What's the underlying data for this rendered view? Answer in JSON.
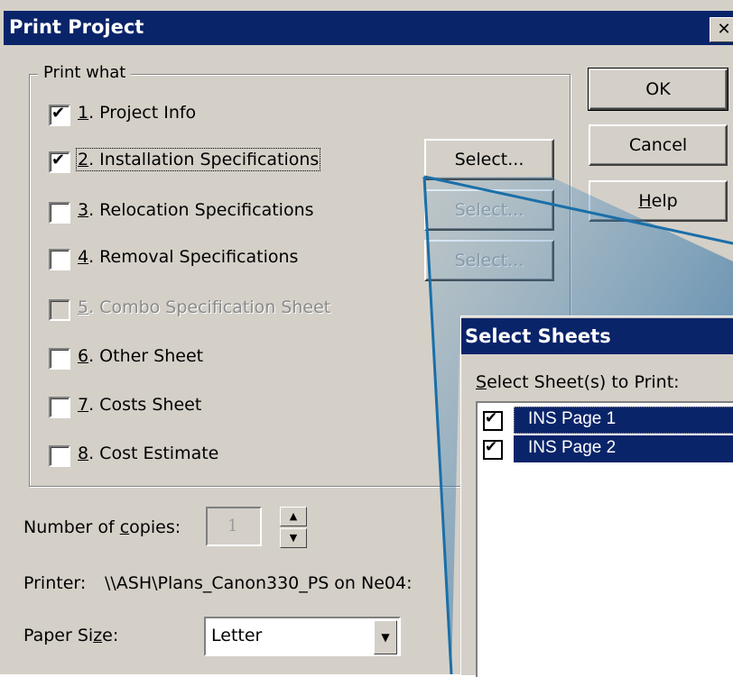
{
  "dialog": {
    "title": "Print Project",
    "close_glyph": "✕"
  },
  "print_what": {
    "label": "Print what",
    "options": [
      {
        "key": "1",
        "rest": ". Project Info",
        "checked": true,
        "enabled": true
      },
      {
        "key": "2",
        "rest": ". Installation Specifications",
        "checked": true,
        "enabled": true
      },
      {
        "key": "3",
        "rest": ". Relocation Specifications",
        "checked": false,
        "enabled": true
      },
      {
        "key": "4",
        "rest": ". Removal Specifications",
        "checked": false,
        "enabled": true
      },
      {
        "key": "5",
        "rest": ". Combo Specification Sheet",
        "checked": false,
        "enabled": false
      },
      {
        "key": "6",
        "rest": ". Other Sheet",
        "checked": false,
        "enabled": true
      },
      {
        "key": "7",
        "rest": ". Costs Sheet",
        "checked": false,
        "enabled": true
      },
      {
        "key": "8",
        "rest": ". Cost Estimate",
        "checked": false,
        "enabled": true
      }
    ],
    "select_label": "Select..."
  },
  "buttons": {
    "ok": "OK",
    "cancel": "Cancel",
    "help_key": "H",
    "help_rest": "elp"
  },
  "copies": {
    "label_pre": "Number of ",
    "label_key": "c",
    "label_post": "opies:",
    "value": "1",
    "up_icon": "▲",
    "down_icon": "▼"
  },
  "printer": {
    "label": "Printer:",
    "value": "\\\\ASH\\Plans_Canon330_PS on Ne04:"
  },
  "paper": {
    "label_pre": "Paper Si",
    "label_key": "z",
    "label_post": "e:",
    "value": "Letter",
    "dropdown_icon": "▼"
  },
  "select_sheets": {
    "title": "Select Sheets",
    "label_key": "S",
    "label_rest": "elect Sheet(s) to Print:",
    "items": [
      {
        "label": "INS Page 1",
        "checked": true
      },
      {
        "label": "INS Page 2",
        "checked": true
      }
    ]
  },
  "colors": {
    "titlebar": "#0a246a",
    "face": "#d4d0c8",
    "callout": "#1a6fa8"
  }
}
